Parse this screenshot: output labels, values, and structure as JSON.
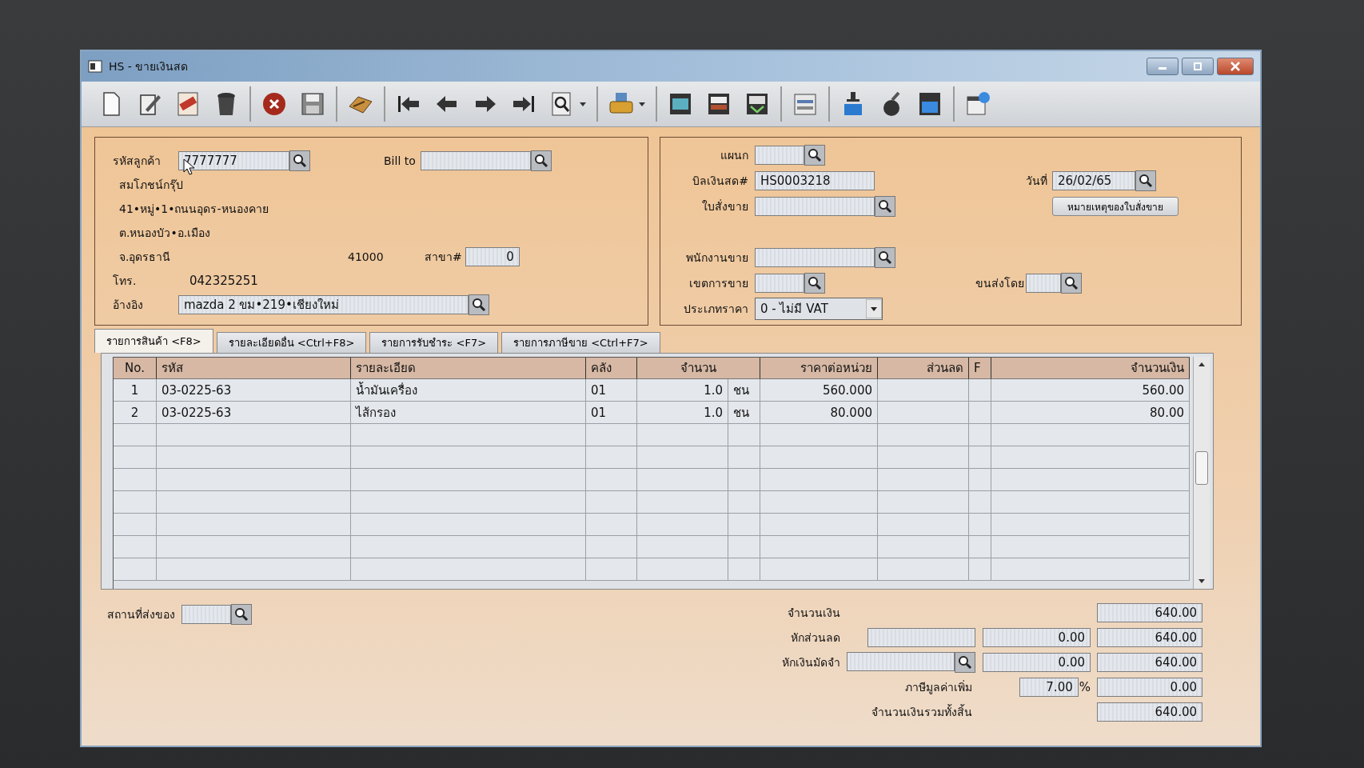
{
  "window": {
    "title": "HS - ขายเงินสด"
  },
  "customer": {
    "code_label": "รหัสลูกค้า",
    "code": "7777777",
    "bill_to_label": "Bill to",
    "name": "สมโภชน์กรุ๊ป",
    "address": [
      "41•หมู่•1•ถนนอุดร-หนองคาย",
      "ต.หนองบัว•อ.เมือง"
    ],
    "province": "จ.อุดรธานี",
    "postcode": "41000",
    "branch_label": "สาขา#",
    "branch": "0",
    "phone_label": "โทร.",
    "phone": "042325251",
    "reference_label": "อ้างอิง",
    "reference": "mazda 2 ขม•219•เชียงใหม่"
  },
  "document": {
    "department_label": "แผนก",
    "bill_no_label": "บิลเงินสด#",
    "bill_no": "HS0003218",
    "sales_order_label": "ใบสั่งขาย",
    "date_label": "วันที่",
    "date": "26/02/65",
    "note_button": "หมายเหตุของใบสั่งขาย",
    "salesperson_label": "พนักงานขาย",
    "sales_area_label": "เขตการขาย",
    "shipped_by_label": "ขนส่งโดย",
    "price_type_label": "ประเภทราคา",
    "price_type": "0 - ไม่มี VAT"
  },
  "tabs": [
    {
      "label": "รายการสินค้า <F8>",
      "selected": true
    },
    {
      "label": "รายละเอียดอื่น <Ctrl+F8>",
      "selected": false
    },
    {
      "label": "รายการรับชำระ <F7>",
      "selected": false
    },
    {
      "label": "รายการภาษีขาย <Ctrl+F7>",
      "selected": false
    }
  ],
  "table": {
    "columns": [
      "No.",
      "รหัส",
      "รายละเอียด",
      "คลัง",
      "จำนวน",
      "ราคาต่อหน่วย",
      "ส่วนลด",
      "F",
      "จำนวนเงิน"
    ],
    "rows": [
      {
        "no": "1",
        "code": "03-0225-63",
        "description": "น้ำมันเครื่อง",
        "warehouse": "01",
        "quantity": "1.0",
        "unit": "ชน",
        "unit_price": "560.000",
        "amount": "560.00"
      },
      {
        "no": "2",
        "code": "03-0225-63",
        "description": "ไส้กรอง",
        "warehouse": "01",
        "quantity": "1.0",
        "unit": "ชน",
        "unit_price": "80.000",
        "amount": "80.00"
      }
    ]
  },
  "delivery": {
    "label": "สถานที่ส่งของ"
  },
  "totals": [
    {
      "kind": "plain",
      "label": "จำนวนเงิน",
      "amount": "640.00"
    },
    {
      "kind": "discount",
      "label": "หักส่วนลด",
      "value": "0.00",
      "amount": "640.00"
    },
    {
      "kind": "lookup",
      "label": "หักเงินมัดจำ",
      "value": "0.00",
      "amount": "640.00"
    },
    {
      "kind": "rate",
      "label": "ภาษีมูลค่าเพิ่ม",
      "value": "7.00",
      "unit": "%",
      "amount": "0.00"
    },
    {
      "kind": "plain",
      "label": "จำนวนเงินรวมทั้งสิ้น",
      "amount": "640.00"
    }
  ]
}
